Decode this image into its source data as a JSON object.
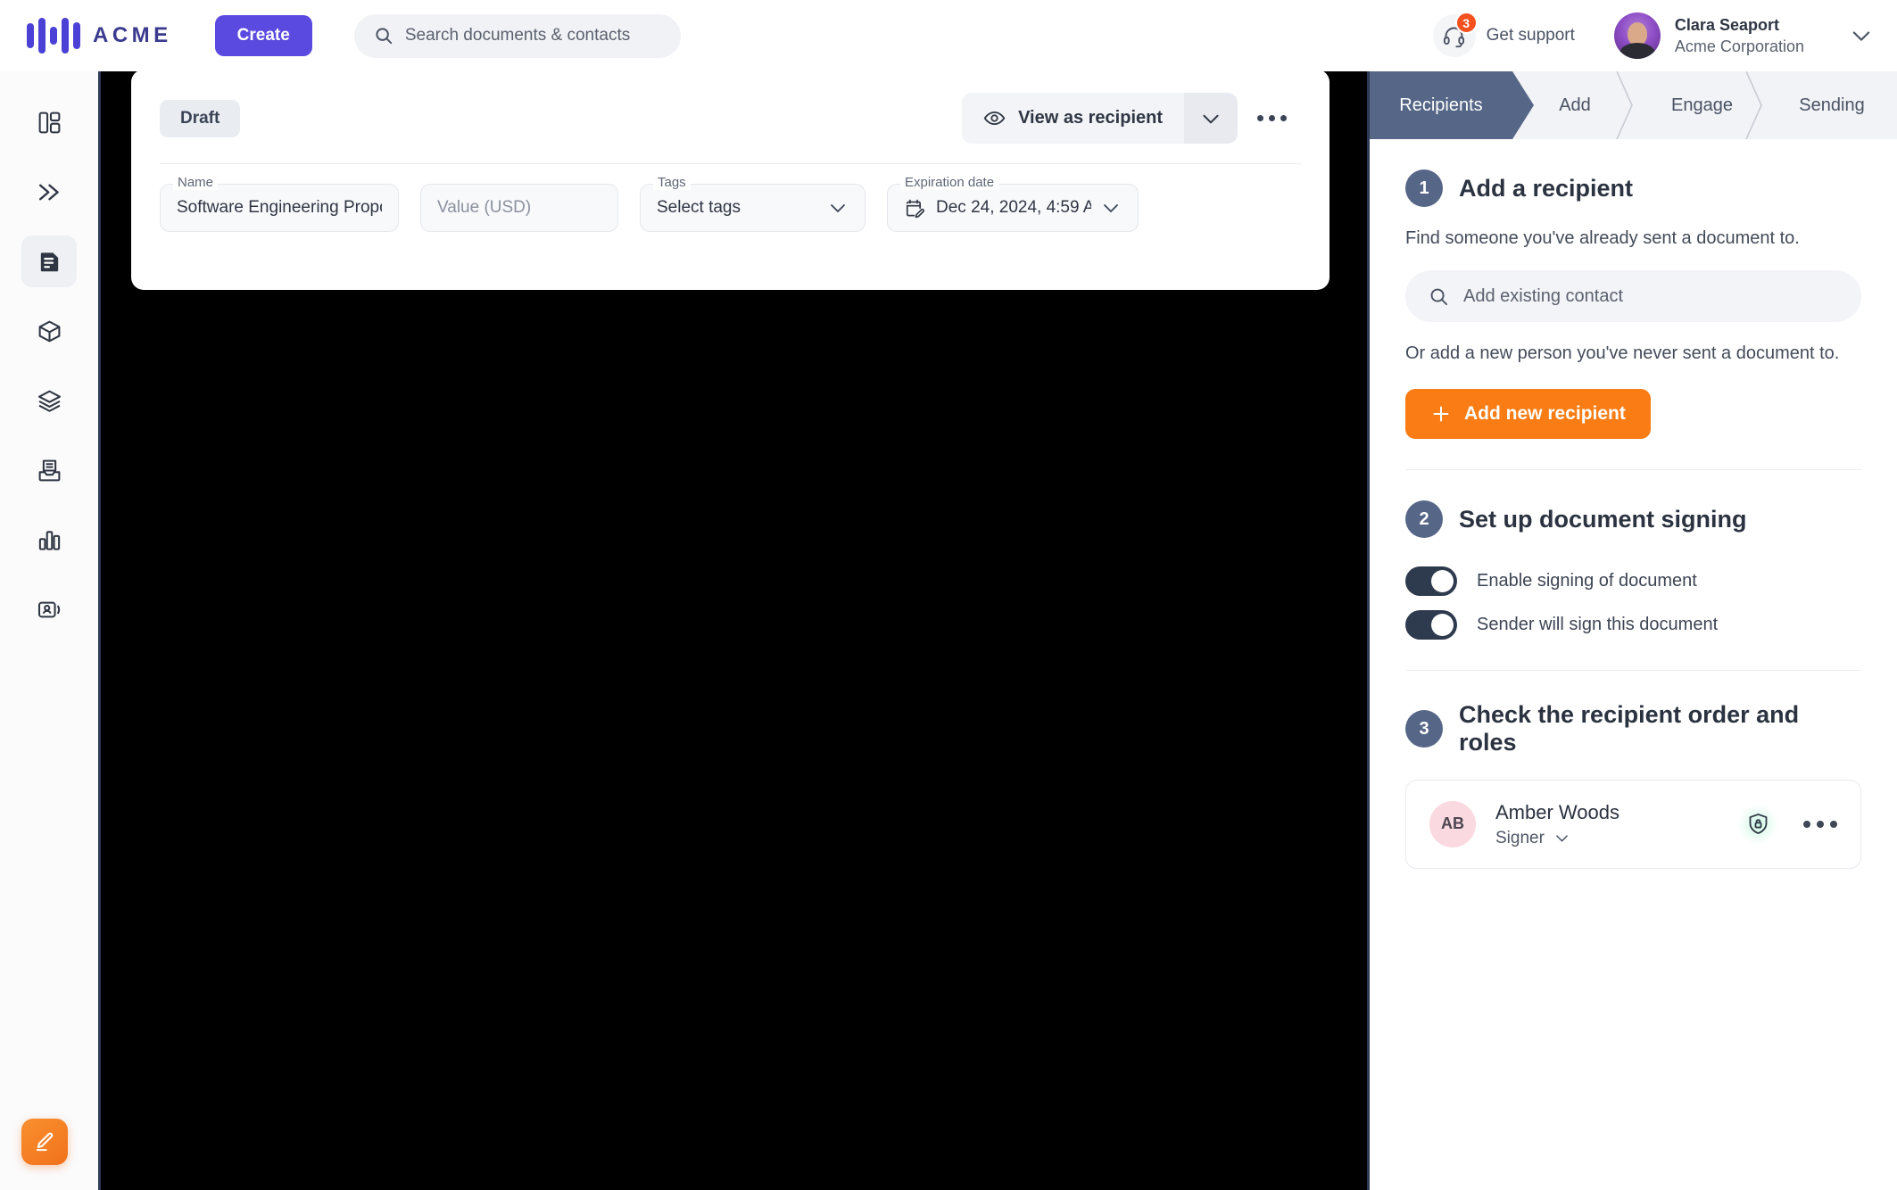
{
  "topbar": {
    "logo_text": "ACME",
    "logo_icon": "acme-bars-logo",
    "create_label": "Create",
    "search": {
      "placeholder": "Search documents & contacts",
      "icon": "search-icon"
    },
    "support": {
      "label": "Get support",
      "badge_count": "3",
      "icon": "headset-icon"
    },
    "user": {
      "name": "Clara Seaport",
      "org": "Acme Corporation",
      "chevron": "chevron-down-icon"
    }
  },
  "rail": {
    "items": [
      {
        "name": "dashboard",
        "icon": "layout-dashboard-icon",
        "active": false
      },
      {
        "name": "quick-actions",
        "icon": "double-chevron-right-icon",
        "active": false
      },
      {
        "name": "documents",
        "icon": "document-lines-icon",
        "active": true
      },
      {
        "name": "products",
        "icon": "cube-icon",
        "active": false
      },
      {
        "name": "templates",
        "icon": "layers-icon",
        "active": false
      },
      {
        "name": "inbox",
        "icon": "document-inbox-icon",
        "active": false
      },
      {
        "name": "reports",
        "icon": "bar-chart-icon",
        "active": false
      },
      {
        "name": "contacts",
        "icon": "contact-card-icon",
        "active": false
      }
    ],
    "fab": {
      "name": "compose-button",
      "icon": "pencil-edit-icon"
    }
  },
  "document": {
    "status_badge": "Draft",
    "view_as_recipient": "View as recipient",
    "view_icon": "eye-icon",
    "view_caret": "chevron-down-icon",
    "more_menu": "more-options-icon",
    "fields": {
      "name": {
        "label": "Name",
        "value": "Software Engineering Proposal"
      },
      "value": {
        "label": "",
        "placeholder": "Value (USD)"
      },
      "tags": {
        "label": "Tags",
        "value": "Select tags"
      },
      "expiration": {
        "label": "Expiration date",
        "value": "Dec 24, 2024, 4:59 A",
        "icon": "calendar-edit-icon"
      }
    }
  },
  "panel": {
    "tabs": [
      {
        "label": "Recipients",
        "active": true
      },
      {
        "label": "Add",
        "active": false
      },
      {
        "label": "Engage",
        "active": false
      },
      {
        "label": "Sending",
        "active": false
      }
    ],
    "section1": {
      "number": "1",
      "title": "Add a recipient",
      "text": "Find someone you've already sent a document to.",
      "search_placeholder": "Add existing contact",
      "search_icon": "search-icon",
      "or_text": "Or add a new person you've never sent a document to.",
      "add_button": "Add new recipient",
      "add_icon": "plus-icon"
    },
    "section2": {
      "number": "2",
      "title": "Set up document signing",
      "toggles": [
        {
          "label": "Enable signing of document",
          "on": true
        },
        {
          "label": "Sender will sign this document",
          "on": true
        }
      ]
    },
    "section3": {
      "number": "3",
      "title": "Check the recipient order and roles",
      "recipients": [
        {
          "initials": "AB",
          "name": "Amber Woods",
          "role": "Signer",
          "role_caret": "chevron-down-icon",
          "security_icon": "shield-lock-icon",
          "more_icon": "more-options-icon"
        }
      ]
    }
  },
  "colors": {
    "brand_purple": "#5b4ae0",
    "accent_orange": "#f97c14",
    "tab_active": "#566686",
    "toggle_on": "#2e3a4d",
    "badge_red": "#f4511e",
    "viewport_bg": "#000000"
  }
}
